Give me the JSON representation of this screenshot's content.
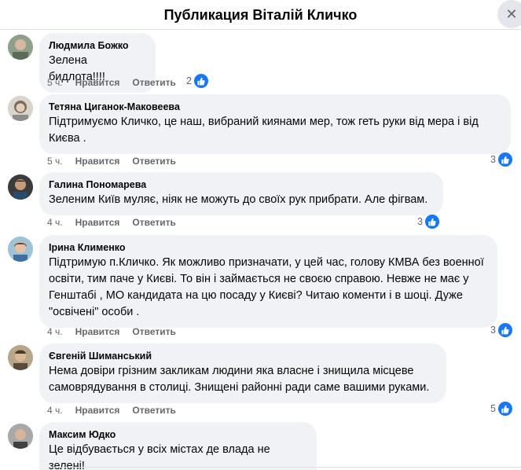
{
  "header": {
    "title": "Публикация Віталій Кличко"
  },
  "comments": [
    {
      "author": "Людмила Божко",
      "text": "Зелена бидлота!!!!",
      "time": "5 ч.",
      "like_label": "Нравится",
      "reply_label": "Ответить",
      "reactions": "2"
    },
    {
      "author": "Тетяна Циганок-Маковеева",
      "text": "Підтримуємо Кличко, це наш, вибраний киянами мер, тож геть руки від мера і від Києва .",
      "time": "5 ч.",
      "like_label": "Нравится",
      "reply_label": "Ответить",
      "reactions": "3"
    },
    {
      "author": "Галина Пономарева",
      "text": "Зеленим Київ муляє, ніяк не можуть до своїх рук прибрати. Але фігвам.",
      "time": "4 ч.",
      "like_label": "Нравится",
      "reply_label": "Ответить",
      "reactions": "3"
    },
    {
      "author": "Ірина Клименко",
      "text": "Підтримую п.Кличко. Як можливо призначати, у цей час, голову КМВА без военної освіти, тим паче у Києві. То він і займається не своєю справою. Невже не має у Генштабі , МО кандидата на цю посаду у Києві? Читаю коменти і в шоці. Дуже \"освічені\" особи .",
      "time": "4 ч.",
      "like_label": "Нравится",
      "reply_label": "Ответить",
      "reactions": "3"
    },
    {
      "author": "Євгеній Шиманський",
      "text": "Нема довіри грізним закликам людини яка власне і знищила місцеве самоврядування в столиці. Знищені районні ради саме вашими руками.",
      "time": "4 ч.",
      "like_label": "Нравится",
      "reply_label": "Ответить",
      "reactions": "5"
    },
    {
      "author": "Максим Юдко",
      "text": "Це відбувається у всіх містах де влада не зелені!"
    }
  ],
  "icons": {
    "close": "close-icon",
    "like": "like-thumb-icon"
  },
  "colors": {
    "accent": "#1877f2",
    "bubble": "#f0f2f5",
    "secondary_text": "#65676b"
  }
}
